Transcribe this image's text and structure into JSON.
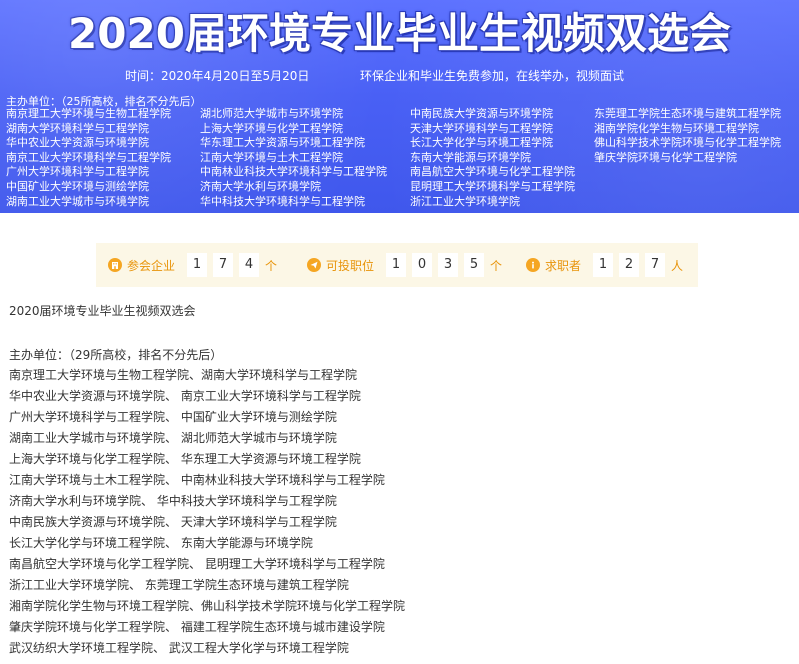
{
  "banner": {
    "title": "2020届环境专业毕业生视频双选会",
    "time": "时间：2020年4月20日至5月20日",
    "note": "环保企业和毕业生免费参加，在线举办，视频面试",
    "host_label": "主办单位：（25所高校，排名不分先后）",
    "host_columns": [
      [
        "南京理工大学环境与生物工程学院",
        "湖南大学环境科学与工程学院",
        "华中农业大学资源与环境学院",
        "南京工业大学环境科学与工程学院",
        "广州大学环境科学与工程学院",
        "中国矿业大学环境与测绘学院",
        "湖南工业大学城市与环境学院"
      ],
      [
        "湖北师范大学城市与环境学院",
        "上海大学环境与化学工程学院",
        "华东理工大学资源与环境工程学院",
        "江南大学环境与土木工程学院",
        "中南林业科技大学环境科学与工程学院",
        "济南大学水利与环境学院",
        "华中科技大学环境科学与工程学院"
      ],
      [
        "中南民族大学资源与环境学院",
        "天津大学环境科学与工程学院",
        "长江大学化学与环境工程学院",
        "东南大学能源与环境学院",
        "南昌航空大学环境与化学工程学院",
        "昆明理工大学环境科学与工程学院",
        "浙江工业大学环境学院"
      ],
      [
        "东莞理工学院生态环境与建筑工程学院",
        "湘南学院化学生物与环境工程学院",
        "佛山科学技术学院环境与化学工程学院",
        "肇庆学院环境与化学工程学院"
      ]
    ]
  },
  "stats": {
    "companies": {
      "label": "参会企业",
      "digits": [
        "1",
        "7",
        "4"
      ],
      "unit": "个"
    },
    "positions": {
      "label": "可投职位",
      "digits": [
        "1",
        "0",
        "3",
        "5"
      ],
      "unit": "个"
    },
    "seekers": {
      "label": "求职者",
      "digits": [
        "1",
        "2",
        "7"
      ],
      "unit": "人"
    }
  },
  "content": {
    "title": "2020届环境专业毕业生视频双选会",
    "host_label": "主办单位：（29所高校，排名不分先后）",
    "lines": [
      "南京理工大学环境与生物工程学院、湖南大学环境科学与工程学院",
      "华中农业大学资源与环境学院、 南京工业大学环境科学与工程学院",
      "广州大学环境科学与工程学院、 中国矿业大学环境与测绘学院",
      "湖南工业大学城市与环境学院、 湖北师范大学城市与环境学院",
      "上海大学环境与化学工程学院、 华东理工大学资源与环境工程学院",
      "江南大学环境与土木工程学院、 中南林业科技大学环境科学与工程学院",
      "济南大学水利与环境学院、 华中科技大学环境科学与工程学院",
      "中南民族大学资源与环境学院、 天津大学环境科学与工程学院",
      "长江大学化学与环境工程学院、 东南大学能源与环境学院",
      "南昌航空大学环境与化学工程学院、 昆明理工大学环境科学与工程学院",
      "浙江工业大学环境学院、 东莞理工学院生态环境与建筑工程学院",
      "湘南学院化学生物与环境工程学院、佛山科学技术学院环境与化学工程学院",
      "肇庆学院环境与化学工程学院、 福建工程学院生态环境与城市建设学院",
      "武汉纺织大学环境工程学院、 武汉工程大学化学与环境工程学院"
    ]
  },
  "colors": {
    "banner": "#4960f5",
    "accent": "#f5a623",
    "stats_bg": "#fcf7e6"
  }
}
